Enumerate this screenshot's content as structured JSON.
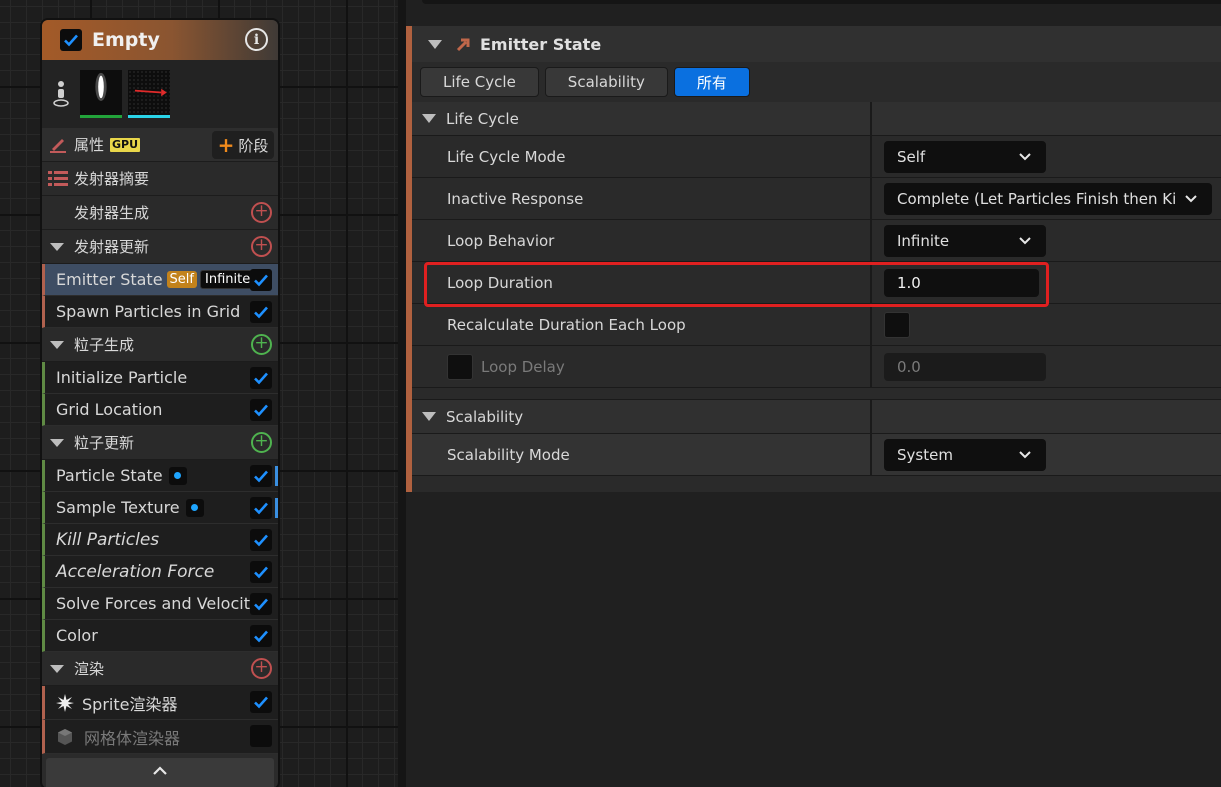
{
  "node": {
    "title": "Empty",
    "properties_label": "属性",
    "gpu_badge": "GPU",
    "stage_button": "阶段",
    "summary_label": "发射器摘要",
    "emitter_spawn": "发射器生成",
    "emitter_update": "发射器更新",
    "emitter_state": {
      "label": "Emitter State",
      "badge_self": "Self",
      "badge_infinite": "Infinite"
    },
    "spawn_grid": "Spawn Particles in Grid",
    "particle_spawn": "粒子生成",
    "init_particle": "Initialize Particle",
    "grid_location": "Grid Location",
    "particle_update": "粒子更新",
    "particle_state": "Particle State",
    "sample_texture": "Sample Texture",
    "kill_particles": "Kill Particles",
    "acceleration_force": "Acceleration Force",
    "solve_forces": "Solve Forces and Velocity",
    "color": "Color",
    "render": "渲染",
    "sprite_renderer": "Sprite渲染器",
    "mesh_renderer": "网格体渲染器"
  },
  "panel": {
    "header": "Emitter State",
    "tabs": [
      "Life Cycle",
      "Scalability",
      "所有"
    ],
    "active_tab": "所有",
    "life_cycle_group": "Life Cycle",
    "rows": {
      "life_cycle_mode": {
        "label": "Life Cycle Mode",
        "value": "Self"
      },
      "inactive_response": {
        "label": "Inactive Response",
        "value": "Complete (Let Particles Finish then Kill"
      },
      "loop_behavior": {
        "label": "Loop Behavior",
        "value": "Infinite"
      },
      "loop_duration": {
        "label": "Loop Duration",
        "value": "1.0"
      },
      "recalculate": {
        "label": "Recalculate Duration Each Loop"
      },
      "loop_delay": {
        "label": "Loop Delay",
        "value": "0.0"
      }
    },
    "scalability_group": "Scalability",
    "scalability_mode": {
      "label": "Scalability Mode",
      "value": "System"
    }
  },
  "colors": {
    "accent_blue": "#0a70e0",
    "highlight_red": "#e02020",
    "emitter_stripe": "#b0614e",
    "particle_stripe": "#5f8a44"
  }
}
